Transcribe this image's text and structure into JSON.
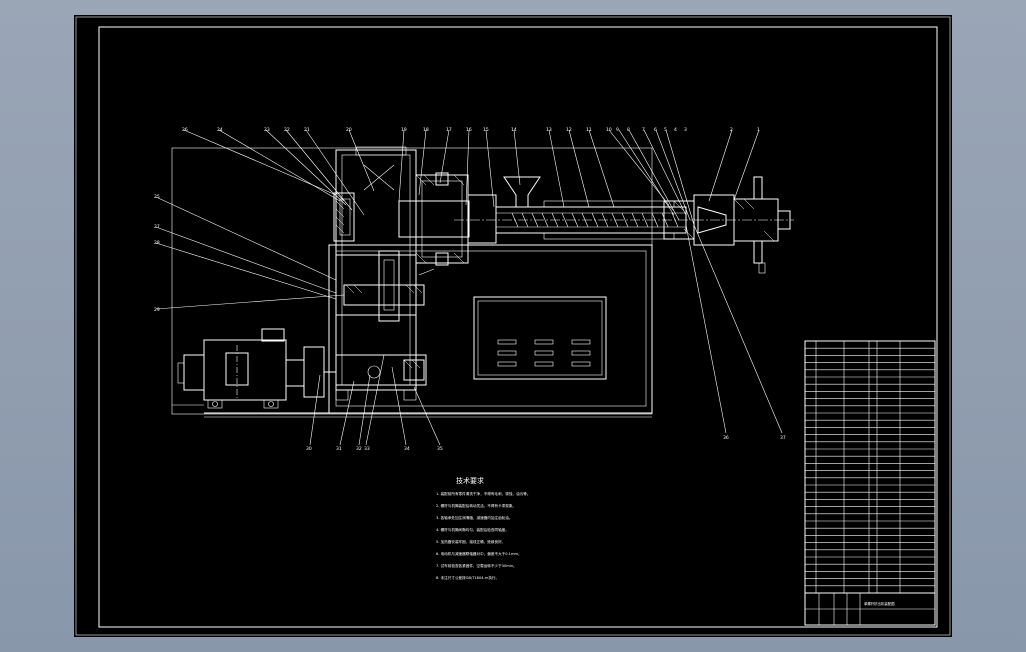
{
  "drawing": {
    "notes_title": "技术要求",
    "notes": [
      "1. 装配前所有零件清洗干净，不得有毛刺、锈蚀、油污等。",
      "2. 螺杆与机筒装配后转动灵活，不得有卡滞现象。",
      "3. 各轴承处加注润滑脂，减速器内加注齿轮油。",
      "4. 螺杆与机筒间隙均匀，装配后检查同轴度。",
      "5. 加热器安装牢固，接线正确，绝缘良好。",
      "6. 电动机与减速器联轴器对中，偏差不大于0.1mm。",
      "7. 试车前检查各紧固件，空载运转不少于30min。",
      "8. 未注尺寸公差按GB/T1804-m执行。"
    ],
    "balloons_top": [
      "26",
      "24",
      "23",
      "22",
      "21",
      "20",
      "19",
      "18",
      "17",
      "16",
      "15",
      "14",
      "13",
      "12",
      "11",
      "10",
      "9",
      "8",
      "7",
      "6",
      "5",
      "4",
      "3",
      "2",
      "1"
    ],
    "balloons_left": [
      "25",
      "27",
      "28",
      "29"
    ],
    "balloons_bottom": [
      "30",
      "31",
      "32",
      "33",
      "34",
      "35"
    ],
    "balloons_right": [
      "36",
      "37"
    ],
    "title_block": {
      "drawing_name": "单螺杆挤出机装配图",
      "rows": 35
    }
  }
}
